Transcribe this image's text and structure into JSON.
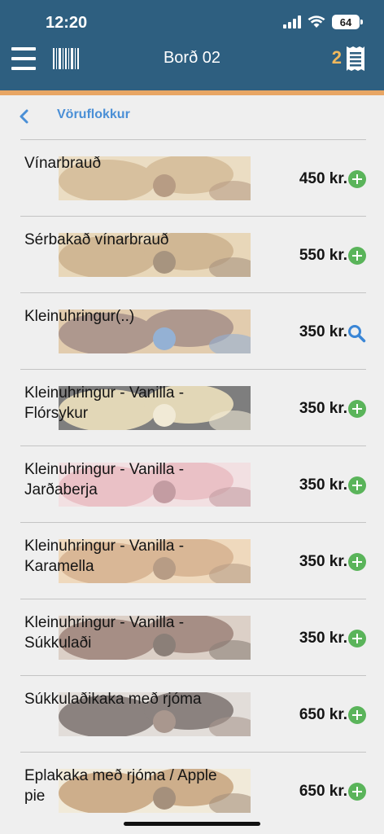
{
  "status_bar": {
    "time": "12:20",
    "battery": "64"
  },
  "header": {
    "title": "Borð 02",
    "cart_count": "2"
  },
  "nav": {
    "title": "Vöruflokkur"
  },
  "items": [
    {
      "name": "Vínarbrauð",
      "price": "450 kr.",
      "action": "add"
    },
    {
      "name": "Sérbakað vínarbrauð",
      "price": "550 kr.",
      "action": "add"
    },
    {
      "name": "Kleinuhringur(..)",
      "price": "350 kr.",
      "action": "search"
    },
    {
      "name": "Kleinuhringur - Vanilla - Flórsykur",
      "price": "350 kr.",
      "action": "add"
    },
    {
      "name": "Kleinuhringur - Vanilla - Jarðaberja",
      "price": "350 kr.",
      "action": "add"
    },
    {
      "name": "Kleinuhringur - Vanilla - Karamella",
      "price": "350 kr.",
      "action": "add"
    },
    {
      "name": "Kleinuhringur - Vanilla - Súkkulaði",
      "price": "350 kr.",
      "action": "add"
    },
    {
      "name": "Súkkulaðikaka með rjóma",
      "price": "650 kr.",
      "action": "add"
    },
    {
      "name": "Eplakaka með rjóma / Apple pie",
      "price": "650 kr.",
      "action": "add"
    }
  ],
  "colors": {
    "header": "#2e5f80",
    "accent": "#e8a664",
    "add": "#5ab45a",
    "link": "#4a8fd6"
  }
}
